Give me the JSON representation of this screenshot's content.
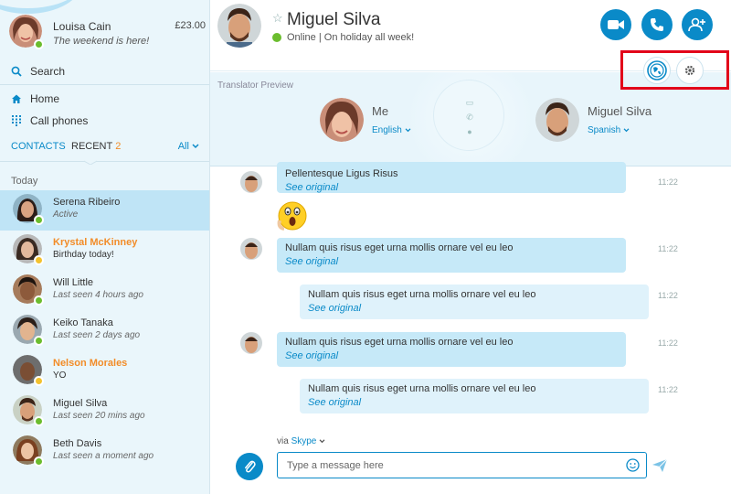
{
  "profile": {
    "name": "Louisa Cain",
    "mood": "The weekend is here!",
    "credit": "£23.00",
    "status": "online"
  },
  "nav": {
    "search": "Search",
    "home": "Home",
    "call_phones": "Call phones"
  },
  "tabs": {
    "contacts": "CONTACTS",
    "recent": "RECENT",
    "recent_count": "2",
    "filter": "All"
  },
  "section_label": "Today",
  "contacts": [
    {
      "name": "Serena Ribeiro",
      "status": "Active",
      "presence": "online",
      "highlight": false,
      "active": true
    },
    {
      "name": "Krystal McKinney",
      "status": "Birthday today!",
      "presence": "away",
      "highlight": true,
      "active": false
    },
    {
      "name": "Will Little",
      "status": "Last seen 4 hours ago",
      "presence": "online",
      "highlight": false,
      "active": false
    },
    {
      "name": "Keiko Tanaka",
      "status": "Last seen 2 days ago",
      "presence": "online",
      "highlight": false,
      "active": false
    },
    {
      "name": "Nelson Morales",
      "status": "YO",
      "presence": "away",
      "highlight": true,
      "active": false
    },
    {
      "name": "Miguel Silva",
      "status": "Last seen 20 mins ago",
      "presence": "online",
      "highlight": false,
      "active": false
    },
    {
      "name": "Beth Davis",
      "status": "Last seen a moment ago",
      "presence": "online",
      "highlight": false,
      "active": false
    }
  ],
  "conversation": {
    "name": "Miguel Silva",
    "status_text": "Online  |  On holiday all week!"
  },
  "translator": {
    "label": "Translator Preview",
    "me_name": "Me",
    "me_lang": "English",
    "other_name": "Miguel Silva",
    "other_lang": "Spanish"
  },
  "messages": [
    {
      "text": "Pellentesque Ligus Risus",
      "link": "See original",
      "time": "11:22",
      "direction": "in"
    },
    {
      "emoji": "surprised-emoji",
      "direction": "in"
    },
    {
      "text": "Nullam quis risus eget urna mollis ornare vel eu leo",
      "link": "See original",
      "time": "11:22",
      "direction": "in"
    },
    {
      "text": "Nullam quis risus eget urna mollis ornare vel eu leo",
      "link": "See original",
      "time": "11:22",
      "direction": "out"
    },
    {
      "text": "Nullam quis risus eget urna mollis ornare vel eu leo",
      "link": "See original",
      "time": "11:22",
      "direction": "in"
    },
    {
      "text": "Nullam quis risus eget urna mollis ornare vel eu leo",
      "link": "See original",
      "time": "11:22",
      "direction": "out"
    }
  ],
  "composer": {
    "via_prefix": "via",
    "via_service": "Skype",
    "placeholder": "Type a message here"
  },
  "colors": {
    "accent": "#0a8ac8",
    "online": "#6bbd2e",
    "away": "#f3c22e",
    "highlight_name": "#f28c28",
    "annotation_box": "#e2001a"
  }
}
